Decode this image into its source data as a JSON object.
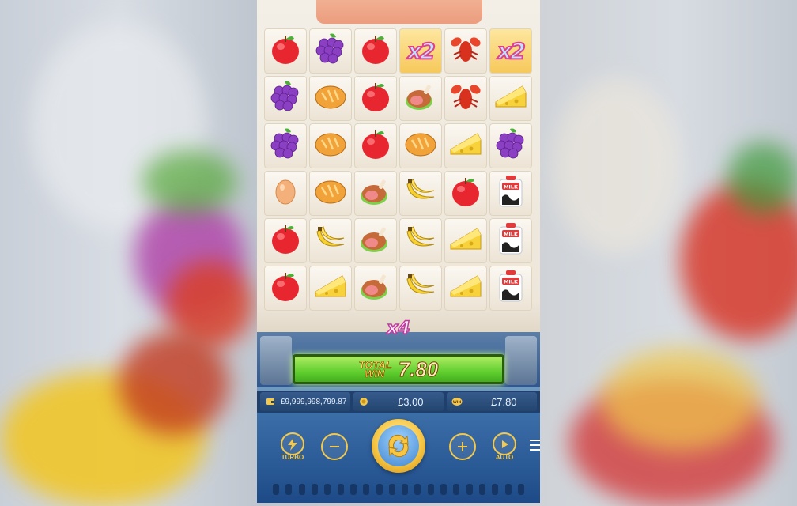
{
  "game": {
    "grid_symbols": [
      [
        "apple-icon",
        "grapes-icon",
        "apple-icon",
        "multiplier-x2-icon",
        "lobster-icon",
        "multiplier-x2-icon"
      ],
      [
        "grapes-icon",
        "bread-icon",
        "apple-icon",
        "ham-icon",
        "lobster-icon",
        "cheese-icon"
      ],
      [
        "grapes-icon",
        "bread-icon",
        "apple-icon",
        "bread-icon",
        "cheese-icon",
        "grapes-icon"
      ],
      [
        "egg-icon",
        "bread-icon",
        "ham-icon",
        "banana-icon",
        "apple-icon",
        "milk-icon"
      ],
      [
        "apple-icon",
        "banana-icon",
        "ham-icon",
        "banana-icon",
        "cheese-icon",
        "milk-icon"
      ],
      [
        "apple-icon",
        "cheese-icon",
        "ham-icon",
        "banana-icon",
        "cheese-icon",
        "milk-icon"
      ]
    ],
    "multiplier_symbol_text": "x2",
    "multiplier": "x4",
    "milk_label": "MILK",
    "total_win_label_1": "TOTAL",
    "total_win_label_2": "WIN",
    "total_win_value": "7.80",
    "balance": "£9,999,998,799.87",
    "bet": "£3.00",
    "win": "£7.80",
    "win_badge": "WIN",
    "turbo_label": "TURBO",
    "auto_label": "AUTO"
  },
  "colors": {
    "accent_gold": "#f2c94c",
    "win_bar_green": "#5fce2e",
    "panel_blue": "#2a5a96"
  }
}
